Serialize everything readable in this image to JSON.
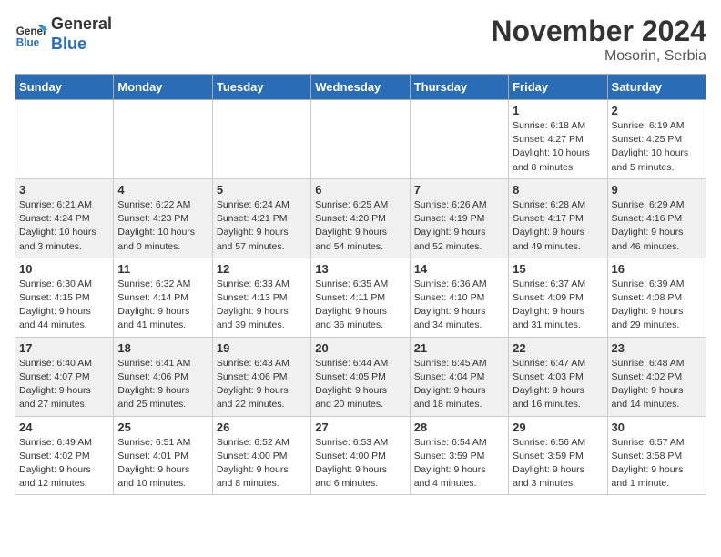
{
  "header": {
    "logo_line1": "General",
    "logo_line2": "Blue",
    "month_year": "November 2024",
    "location": "Mosorin, Serbia"
  },
  "weekdays": [
    "Sunday",
    "Monday",
    "Tuesday",
    "Wednesday",
    "Thursday",
    "Friday",
    "Saturday"
  ],
  "weeks": [
    [
      {
        "day": "",
        "info": ""
      },
      {
        "day": "",
        "info": ""
      },
      {
        "day": "",
        "info": ""
      },
      {
        "day": "",
        "info": ""
      },
      {
        "day": "",
        "info": ""
      },
      {
        "day": "1",
        "info": "Sunrise: 6:18 AM\nSunset: 4:27 PM\nDaylight: 10 hours\nand 8 minutes."
      },
      {
        "day": "2",
        "info": "Sunrise: 6:19 AM\nSunset: 4:25 PM\nDaylight: 10 hours\nand 5 minutes."
      }
    ],
    [
      {
        "day": "3",
        "info": "Sunrise: 6:21 AM\nSunset: 4:24 PM\nDaylight: 10 hours\nand 3 minutes."
      },
      {
        "day": "4",
        "info": "Sunrise: 6:22 AM\nSunset: 4:23 PM\nDaylight: 10 hours\nand 0 minutes."
      },
      {
        "day": "5",
        "info": "Sunrise: 6:24 AM\nSunset: 4:21 PM\nDaylight: 9 hours\nand 57 minutes."
      },
      {
        "day": "6",
        "info": "Sunrise: 6:25 AM\nSunset: 4:20 PM\nDaylight: 9 hours\nand 54 minutes."
      },
      {
        "day": "7",
        "info": "Sunrise: 6:26 AM\nSunset: 4:19 PM\nDaylight: 9 hours\nand 52 minutes."
      },
      {
        "day": "8",
        "info": "Sunrise: 6:28 AM\nSunset: 4:17 PM\nDaylight: 9 hours\nand 49 minutes."
      },
      {
        "day": "9",
        "info": "Sunrise: 6:29 AM\nSunset: 4:16 PM\nDaylight: 9 hours\nand 46 minutes."
      }
    ],
    [
      {
        "day": "10",
        "info": "Sunrise: 6:30 AM\nSunset: 4:15 PM\nDaylight: 9 hours\nand 44 minutes."
      },
      {
        "day": "11",
        "info": "Sunrise: 6:32 AM\nSunset: 4:14 PM\nDaylight: 9 hours\nand 41 minutes."
      },
      {
        "day": "12",
        "info": "Sunrise: 6:33 AM\nSunset: 4:13 PM\nDaylight: 9 hours\nand 39 minutes."
      },
      {
        "day": "13",
        "info": "Sunrise: 6:35 AM\nSunset: 4:11 PM\nDaylight: 9 hours\nand 36 minutes."
      },
      {
        "day": "14",
        "info": "Sunrise: 6:36 AM\nSunset: 4:10 PM\nDaylight: 9 hours\nand 34 minutes."
      },
      {
        "day": "15",
        "info": "Sunrise: 6:37 AM\nSunset: 4:09 PM\nDaylight: 9 hours\nand 31 minutes."
      },
      {
        "day": "16",
        "info": "Sunrise: 6:39 AM\nSunset: 4:08 PM\nDaylight: 9 hours\nand 29 minutes."
      }
    ],
    [
      {
        "day": "17",
        "info": "Sunrise: 6:40 AM\nSunset: 4:07 PM\nDaylight: 9 hours\nand 27 minutes."
      },
      {
        "day": "18",
        "info": "Sunrise: 6:41 AM\nSunset: 4:06 PM\nDaylight: 9 hours\nand 25 minutes."
      },
      {
        "day": "19",
        "info": "Sunrise: 6:43 AM\nSunset: 4:06 PM\nDaylight: 9 hours\nand 22 minutes."
      },
      {
        "day": "20",
        "info": "Sunrise: 6:44 AM\nSunset: 4:05 PM\nDaylight: 9 hours\nand 20 minutes."
      },
      {
        "day": "21",
        "info": "Sunrise: 6:45 AM\nSunset: 4:04 PM\nDaylight: 9 hours\nand 18 minutes."
      },
      {
        "day": "22",
        "info": "Sunrise: 6:47 AM\nSunset: 4:03 PM\nDaylight: 9 hours\nand 16 minutes."
      },
      {
        "day": "23",
        "info": "Sunrise: 6:48 AM\nSunset: 4:02 PM\nDaylight: 9 hours\nand 14 minutes."
      }
    ],
    [
      {
        "day": "24",
        "info": "Sunrise: 6:49 AM\nSunset: 4:02 PM\nDaylight: 9 hours\nand 12 minutes."
      },
      {
        "day": "25",
        "info": "Sunrise: 6:51 AM\nSunset: 4:01 PM\nDaylight: 9 hours\nand 10 minutes."
      },
      {
        "day": "26",
        "info": "Sunrise: 6:52 AM\nSunset: 4:00 PM\nDaylight: 9 hours\nand 8 minutes."
      },
      {
        "day": "27",
        "info": "Sunrise: 6:53 AM\nSunset: 4:00 PM\nDaylight: 9 hours\nand 6 minutes."
      },
      {
        "day": "28",
        "info": "Sunrise: 6:54 AM\nSunset: 3:59 PM\nDaylight: 9 hours\nand 4 minutes."
      },
      {
        "day": "29",
        "info": "Sunrise: 6:56 AM\nSunset: 3:59 PM\nDaylight: 9 hours\nand 3 minutes."
      },
      {
        "day": "30",
        "info": "Sunrise: 6:57 AM\nSunset: 3:58 PM\nDaylight: 9 hours\nand 1 minute."
      }
    ]
  ]
}
